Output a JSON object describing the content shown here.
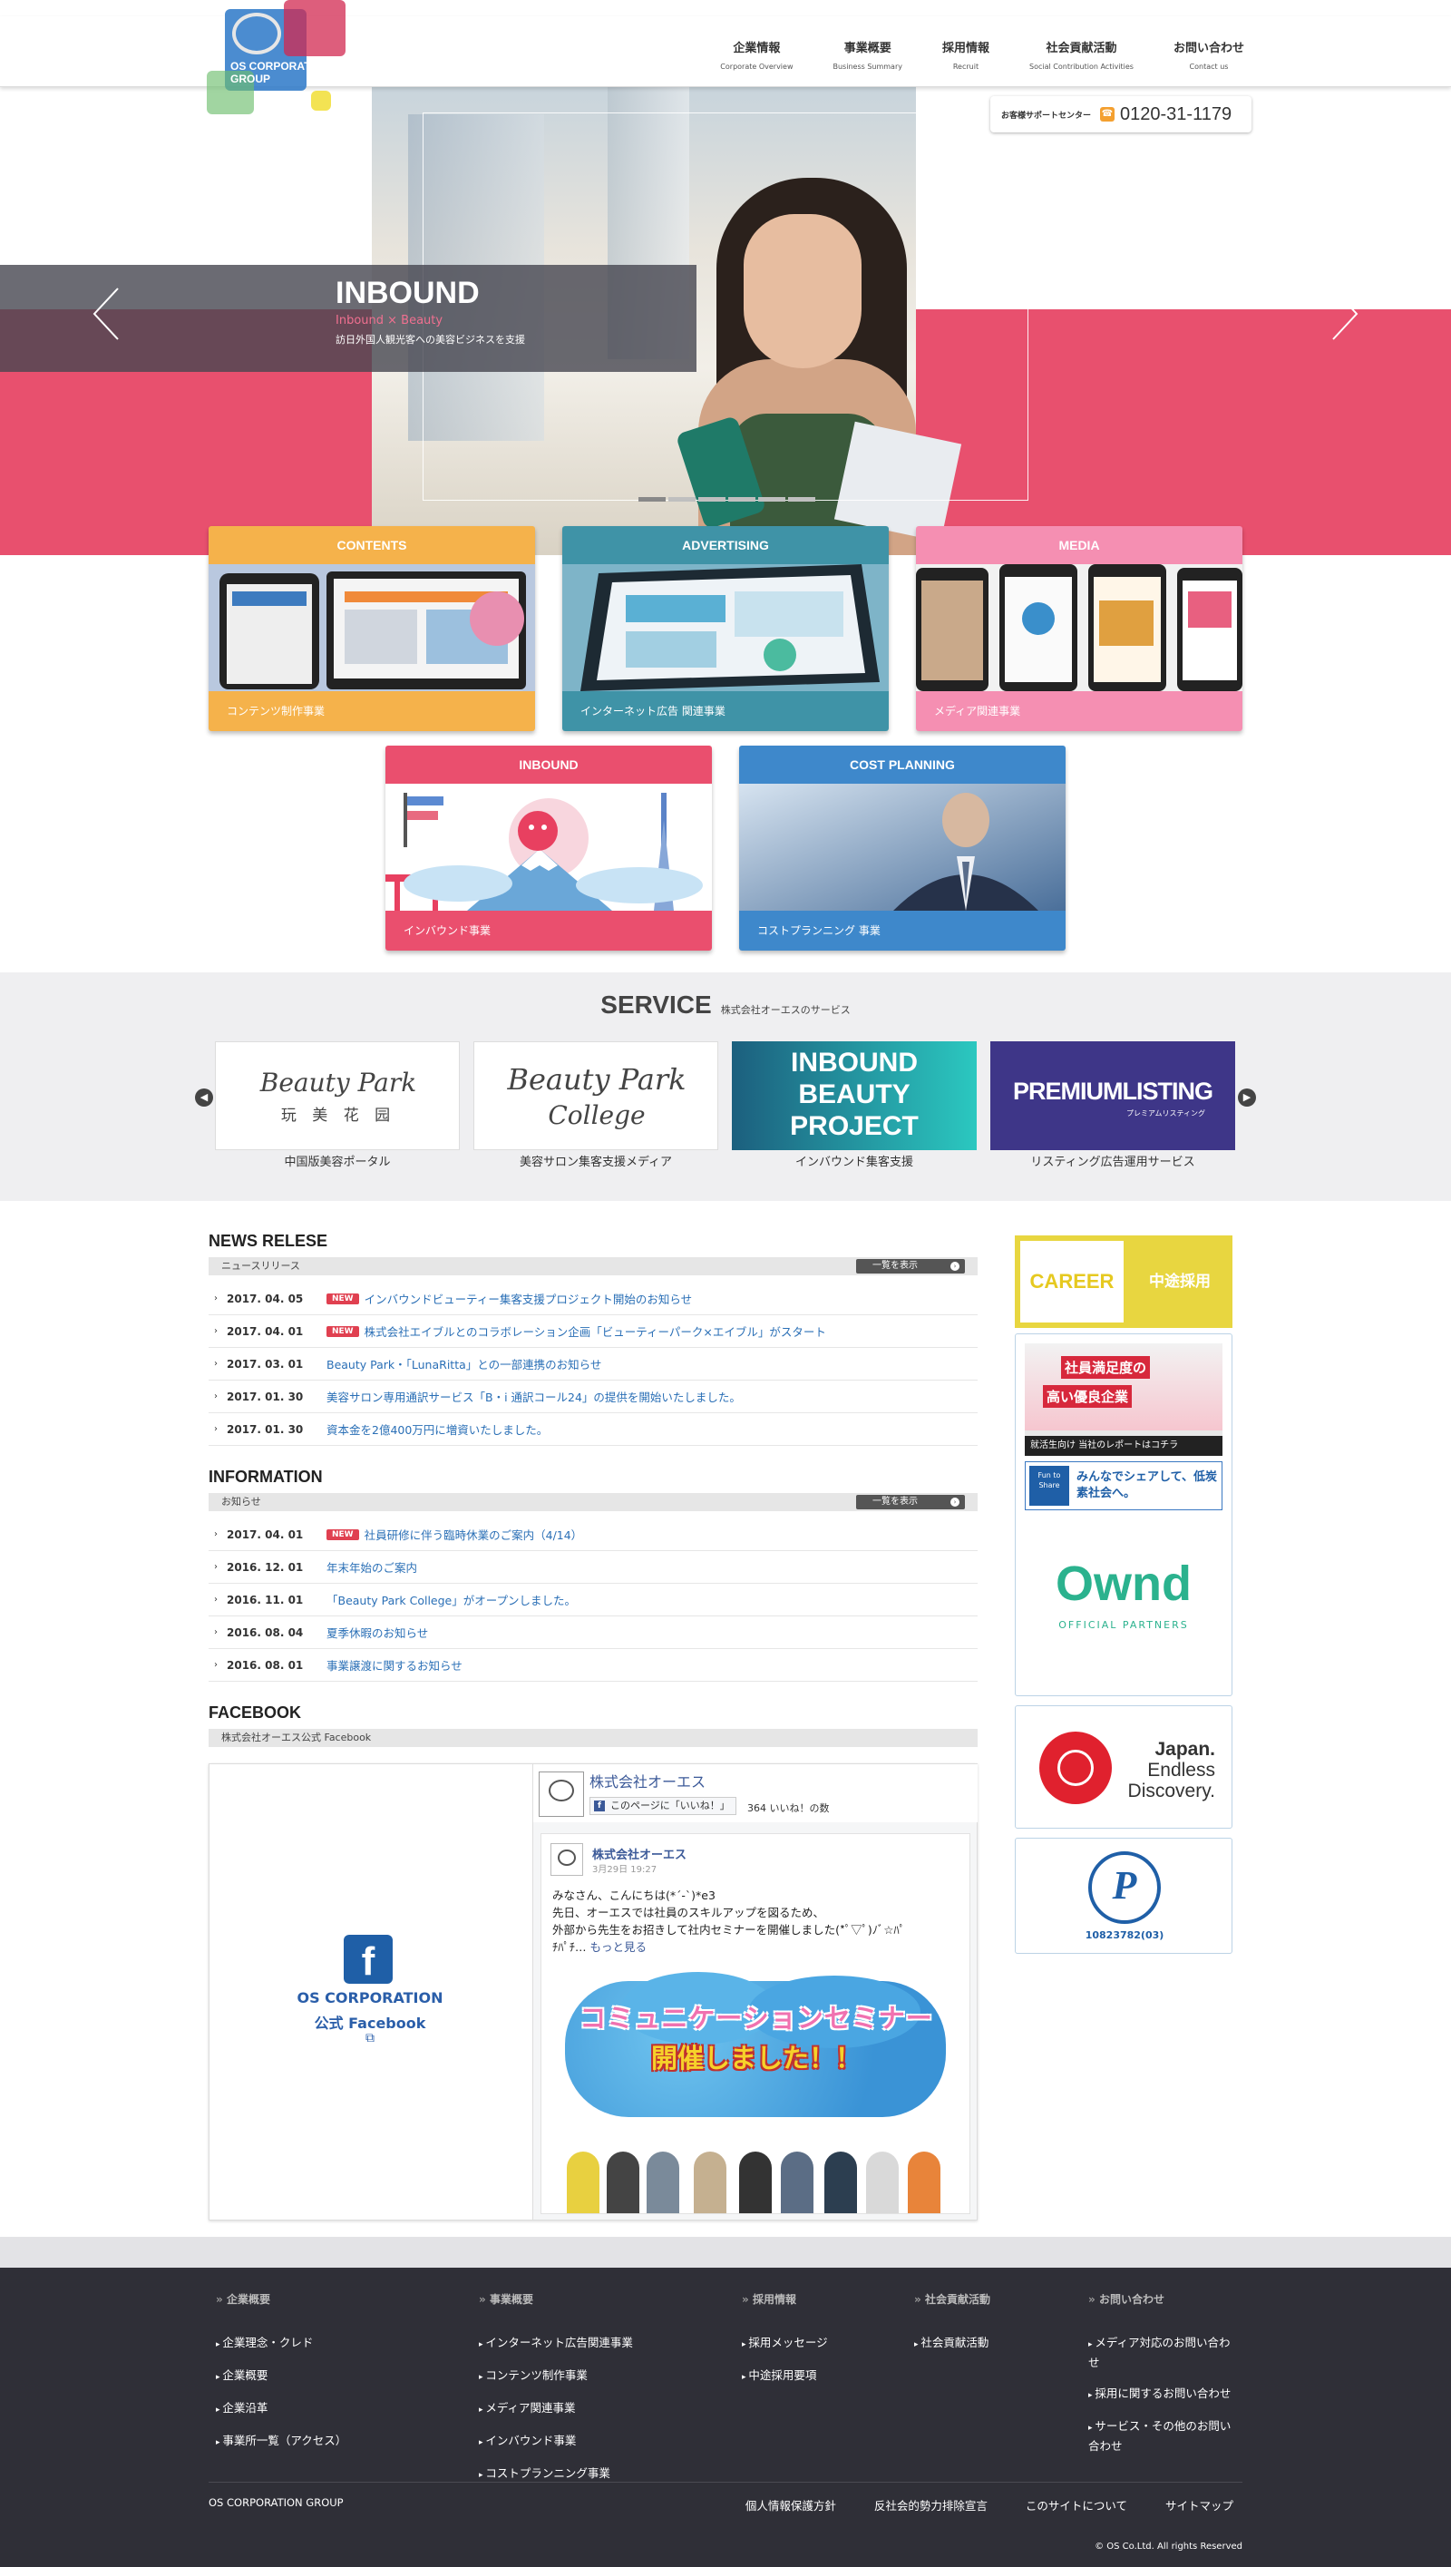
{
  "header": {
    "logo_text": "OS CORPORATION GROUP",
    "nav": [
      {
        "jp": "企業情報",
        "en": "Corporate Overview"
      },
      {
        "jp": "事業概要",
        "en": "Business Summary"
      },
      {
        "jp": "採用情報",
        "en": "Recruit"
      },
      {
        "jp": "社会貢献活動",
        "en": "Social Contribution Activities"
      },
      {
        "jp": "お問い合わせ",
        "en": "Contact us"
      }
    ],
    "support_label": "お客様サポートセンター",
    "support_phone": "0120-31-1179"
  },
  "hero": {
    "title": "INBOUND",
    "subtitle": "Inbound × Beauty",
    "description": "訪日外国人観光客への美容ビジネスを支援",
    "slide_count": 6,
    "active_slide": 1,
    "colors": {
      "band": "#e8506e"
    }
  },
  "business": [
    {
      "title": "CONTENTS",
      "caption": "コンテンツ制作事業",
      "color": "#f5b24b"
    },
    {
      "title": "ADVERTISING",
      "caption": "インターネット広告 関連事業",
      "color": "#3f93a7"
    },
    {
      "title": "MEDIA",
      "caption": "メディア関連事業",
      "color": "#f58fb2"
    },
    {
      "title": "INBOUND",
      "caption": "インバウンド事業",
      "color": "#ea4f6e"
    },
    {
      "title": "COST PLANNING",
      "caption": "コストプランニング 事業",
      "color": "#3e88cb"
    }
  ],
  "service": {
    "heading": "SERVICE",
    "subheading": "株式会社オーエスのサービス",
    "items": [
      {
        "logo": "Beauty Park",
        "logo_sub": "玩 美 花 园",
        "caption": "中国版美容ポータル"
      },
      {
        "logo": "Beauty Park",
        "logo_sub": "College",
        "caption": "美容サロン集客支援メディア"
      },
      {
        "logo": "INBOUND BEAUTY PROJECT",
        "caption": "インバウンド集客支援"
      },
      {
        "logo": "PREMIUMLISTING",
        "logo_sub": "プレミアムリスティング",
        "caption": "リスティング広告運用サービス"
      }
    ]
  },
  "news": {
    "heading": "NEWS RELESE",
    "subheading": "ニュースリリース",
    "more": "一覧を表示",
    "items": [
      {
        "date": "2017. 04. 05",
        "new": "NEW",
        "title": "インバウンドビューティー集客支援プロジェクト開始のお知らせ"
      },
      {
        "date": "2017. 04. 01",
        "new": "NEW",
        "title": "株式会社エイブルとのコラボレーション企画「ビューティーパーク×エイブル」がスタート"
      },
      {
        "date": "2017. 03. 01",
        "new": "",
        "title": "Beauty Park・「LunaRitta」との一部連携のお知らせ"
      },
      {
        "date": "2017. 01. 30",
        "new": "",
        "title": "美容サロン専用通訳サービス「B・i 通訳コール24」の提供を開始いたしました。"
      },
      {
        "date": "2017. 01. 30",
        "new": "",
        "title": "資本金を2億400万円に増資いたしました。"
      }
    ]
  },
  "information": {
    "heading": "INFORMATION",
    "subheading": "お知らせ",
    "more": "一覧を表示",
    "items": [
      {
        "date": "2017. 04. 01",
        "new": "NEW",
        "title": "社員研修に伴う臨時休業のご案内（4/14）"
      },
      {
        "date": "2016. 12. 01",
        "new": "",
        "title": "年末年始のご案内"
      },
      {
        "date": "2016. 11. 01",
        "new": "",
        "title": "「Beauty Park College」がオープンしました。"
      },
      {
        "date": "2016. 08. 04",
        "new": "",
        "title": "夏季休暇のお知らせ"
      },
      {
        "date": "2016. 08. 01",
        "new": "",
        "title": "事業譲渡に関するお知らせ"
      }
    ]
  },
  "facebook": {
    "heading": "FACEBOOK",
    "subheading": "株式会社オーエス公式 Facebook",
    "left_line1": "OS CORPORATION",
    "left_line2": "公式 Facebook",
    "page_name": "株式会社オーエス",
    "like_label": "このページに「いいね！」",
    "like_count": "364 いいね！の数",
    "post_author": "株式会社オーエス",
    "post_date": "3月29日 19:27",
    "post_line1": "みなさん、こんにちは(*´-`)*e3",
    "post_line2": "先日、オーエスでは社員のスキルアップを図るため、",
    "post_line3": "外部から先生をお招きして社内セミナーを開催しました(*ﾟ▽ﾟ)ﾉﾞ☆ﾊﾟ",
    "post_line4": "ﾁﾊﾟﾁ…",
    "post_more": "もっと見る",
    "image_text1": "コミュニケーションセミナー",
    "image_text2": "開催しました！！"
  },
  "sidebar": {
    "career_en": "CAREER",
    "career_jp": "中途採用",
    "banner1_line1": "社員満足度の",
    "banner1_line2": "高い優良企業",
    "banner1_foot": "就活生向け 当社のレポートはコチラ",
    "banner2": "みんなでシェアして、低炭素社会へ。",
    "banner2_icon": "Fun to Share",
    "ownd": "Ownd",
    "ownd_sub": "OFFICIAL PARTNERS",
    "japan_line1": "Japan.",
    "japan_line2": "Endless",
    "japan_line3": "Discovery.",
    "privacy_text": "10823782(03)"
  },
  "footer": {
    "columns": [
      {
        "heading": "企業概要",
        "items": [
          "企業理念・クレド",
          "企業概要",
          "企業沿革",
          "事業所一覧（アクセス）"
        ]
      },
      {
        "heading": "事業概要",
        "items": [
          "インターネット広告関連事業",
          "コンテンツ制作事業",
          "メディア関連事業",
          "インバウンド事業",
          "コストプランニング事業"
        ]
      },
      {
        "heading": "採用情報",
        "items": [
          "採用メッセージ",
          "中途採用要項"
        ]
      },
      {
        "heading": "社会貢献活動",
        "items": [
          "社会貢献活動"
        ]
      },
      {
        "heading": "お問い合わせ",
        "items": [
          "メディア対応のお問い合わせ",
          "採用に関するお問い合わせ",
          "サービス・その他のお問い合わせ"
        ]
      }
    ],
    "group": "OS CORPORATION GROUP",
    "links": [
      "個人情報保護方針",
      "反社会的勢力排除宣言",
      "このサイトについて",
      "サイトマップ"
    ],
    "copyright": "© OS Co.Ltd. All rights Reserved"
  }
}
